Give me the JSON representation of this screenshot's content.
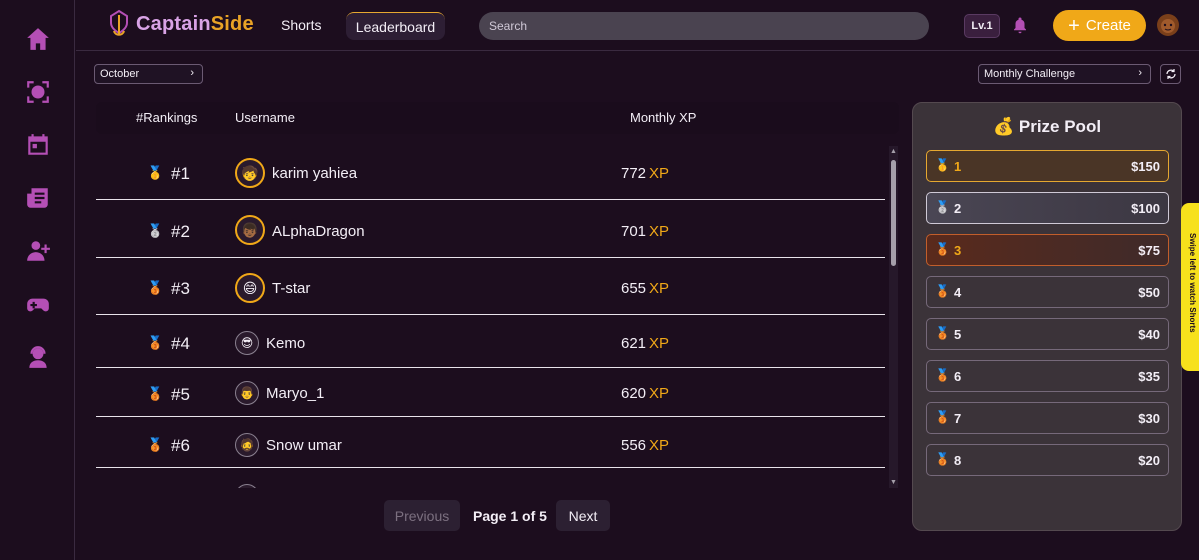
{
  "brand": {
    "name_part1": "Captain",
    "name_part2": "Side"
  },
  "nav": {
    "shorts": "Shorts",
    "leaderboard": "Leaderboard"
  },
  "search": {
    "placeholder": "Search"
  },
  "user": {
    "level": "Lv.1"
  },
  "create": {
    "label": "Create"
  },
  "filters": {
    "month": "October",
    "challenge": "Monthly Challenge"
  },
  "table": {
    "headers": {
      "rankings": "#Rankings",
      "username": "Username",
      "xp": "Monthly XP"
    },
    "xp_unit": "XP",
    "rows": [
      {
        "rank": "#1",
        "username": "karim yahiea",
        "xp": "772"
      },
      {
        "rank": "#2",
        "username": "ALphaDragon",
        "xp": "701"
      },
      {
        "rank": "#3",
        "username": "T-star",
        "xp": "655"
      },
      {
        "rank": "#4",
        "username": "Kemo",
        "xp": "621"
      },
      {
        "rank": "#5",
        "username": "Maryo_1",
        "xp": "620"
      },
      {
        "rank": "#6",
        "username": "Snow umar",
        "xp": "556"
      }
    ]
  },
  "pagination": {
    "previous": "Previous",
    "label": "Page 1 of 5",
    "next": "Next"
  },
  "prize_pool": {
    "title": "Prize Pool",
    "items": [
      {
        "rank": "1",
        "amount": "$150"
      },
      {
        "rank": "2",
        "amount": "$100"
      },
      {
        "rank": "3",
        "amount": "$75"
      },
      {
        "rank": "4",
        "amount": "$50"
      },
      {
        "rank": "5",
        "amount": "$40"
      },
      {
        "rank": "6",
        "amount": "$35"
      },
      {
        "rank": "7",
        "amount": "$30"
      },
      {
        "rank": "8",
        "amount": "$20"
      }
    ]
  },
  "swipe_hint": "Swipe left to watch Shorts",
  "colors": {
    "accent": "#f0a818",
    "brand_purple": "#b44fb5",
    "background": "#1c0d1e"
  }
}
